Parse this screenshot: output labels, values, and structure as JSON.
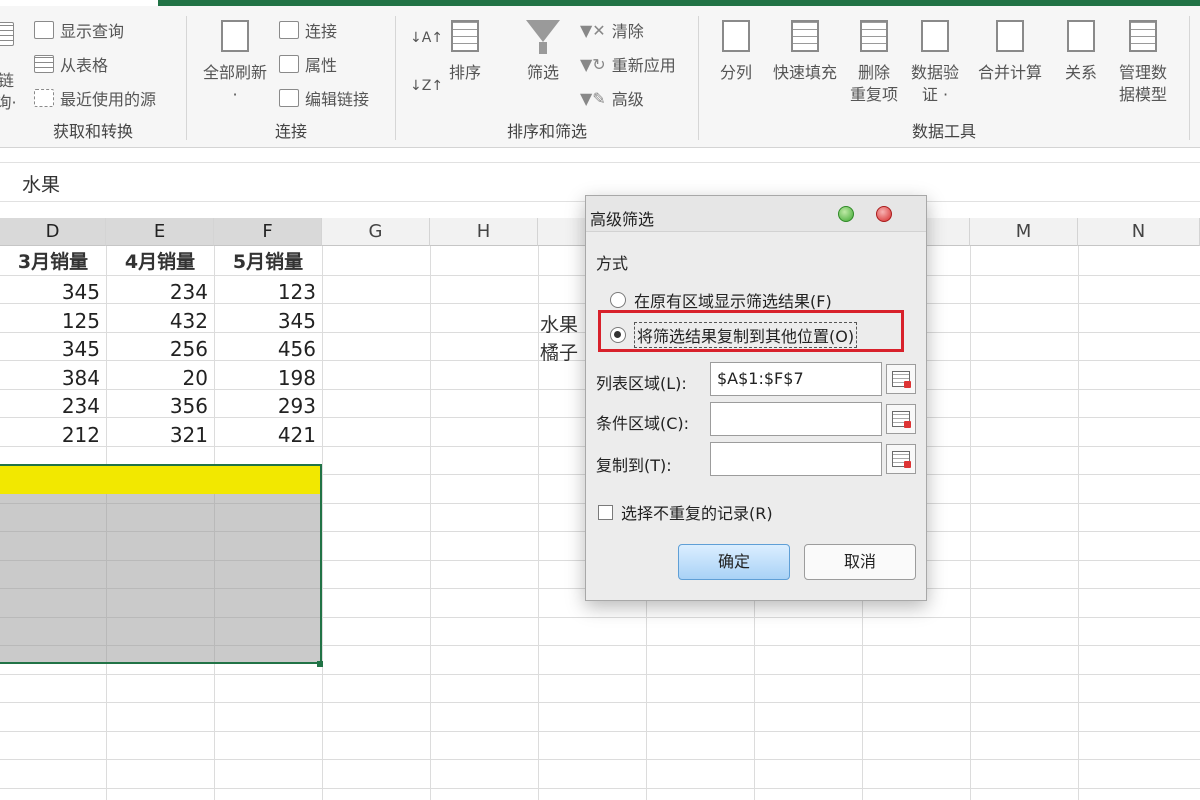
{
  "ribbon": {
    "get_transform": {
      "items": [
        "显示查询",
        "从表格",
        "最近使用的源"
      ],
      "partial_label_1": "链",
      "partial_label_2": "询·",
      "group_label": "获取和转换"
    },
    "connections": {
      "refresh_all_label": "全部刷新",
      "refresh_all_sub": "·",
      "items": [
        "连接",
        "属性",
        "编辑链接"
      ],
      "group_label": "连接"
    },
    "sort_filter": {
      "sort_label": "排序",
      "filter_label": "筛选",
      "items": [
        "清除",
        "重新应用",
        "高级"
      ],
      "group_label": "排序和筛选"
    },
    "data_tools": {
      "items": [
        {
          "line1": "分列",
          "line2": ""
        },
        {
          "line1": "快速填充",
          "line2": ""
        },
        {
          "line1": "删除",
          "line2": "重复项"
        },
        {
          "line1": "数据验",
          "line2": "证 ·"
        },
        {
          "line1": "合并计算",
          "line2": ""
        },
        {
          "line1": "关系",
          "line2": ""
        },
        {
          "line1": "管理数",
          "line2": "据模型"
        }
      ],
      "group_label": "数据工具"
    }
  },
  "formula_bar": {
    "value": "水果"
  },
  "sheet": {
    "columns": [
      {
        "label": "D",
        "selected": true
      },
      {
        "label": "E",
        "selected": true
      },
      {
        "label": "F",
        "selected": true
      },
      {
        "label": "G",
        "selected": false
      },
      {
        "label": "H",
        "selected": false
      },
      {
        "label": "",
        "selected": false
      },
      {
        "label": "",
        "selected": false
      },
      {
        "label": "",
        "selected": false
      },
      {
        "label": "",
        "selected": false
      },
      {
        "label": "M",
        "selected": false
      },
      {
        "label": "N",
        "selected": false
      }
    ],
    "header_row": [
      "3月销量",
      "4月销量",
      "5月销量"
    ],
    "rows": [
      [
        "345",
        "234",
        "123"
      ],
      [
        "125",
        "432",
        "345"
      ],
      [
        "345",
        "256",
        "456"
      ],
      [
        "384",
        "20",
        "198"
      ],
      [
        "234",
        "356",
        "293"
      ],
      [
        "212",
        "321",
        "421"
      ]
    ],
    "side_text_1": "水果",
    "side_text_2": "橘子",
    "header_fill_color": "#f2e800",
    "selection_border_color": "#217346"
  },
  "dialog": {
    "title": "高级筛选",
    "section_label": "方式",
    "radio_option_1": "在原有区域显示筛选结果(F)",
    "radio_option_2": "将筛选结果复制到其他位置(O)",
    "selected_option": 2,
    "list_range_label": "列表区域(L):",
    "list_range_value": "$A$1:$F$7",
    "criteria_range_label": "条件区域(C):",
    "criteria_range_value": "",
    "copy_to_label": "复制到(T):",
    "copy_to_value": "",
    "unique_records_label": "选择不重复的记录(R)",
    "unique_records_checked": false,
    "ok_label": "确定",
    "cancel_label": "取消",
    "highlight_color": "#d8212b"
  },
  "colors": {
    "brand": "#217346"
  }
}
